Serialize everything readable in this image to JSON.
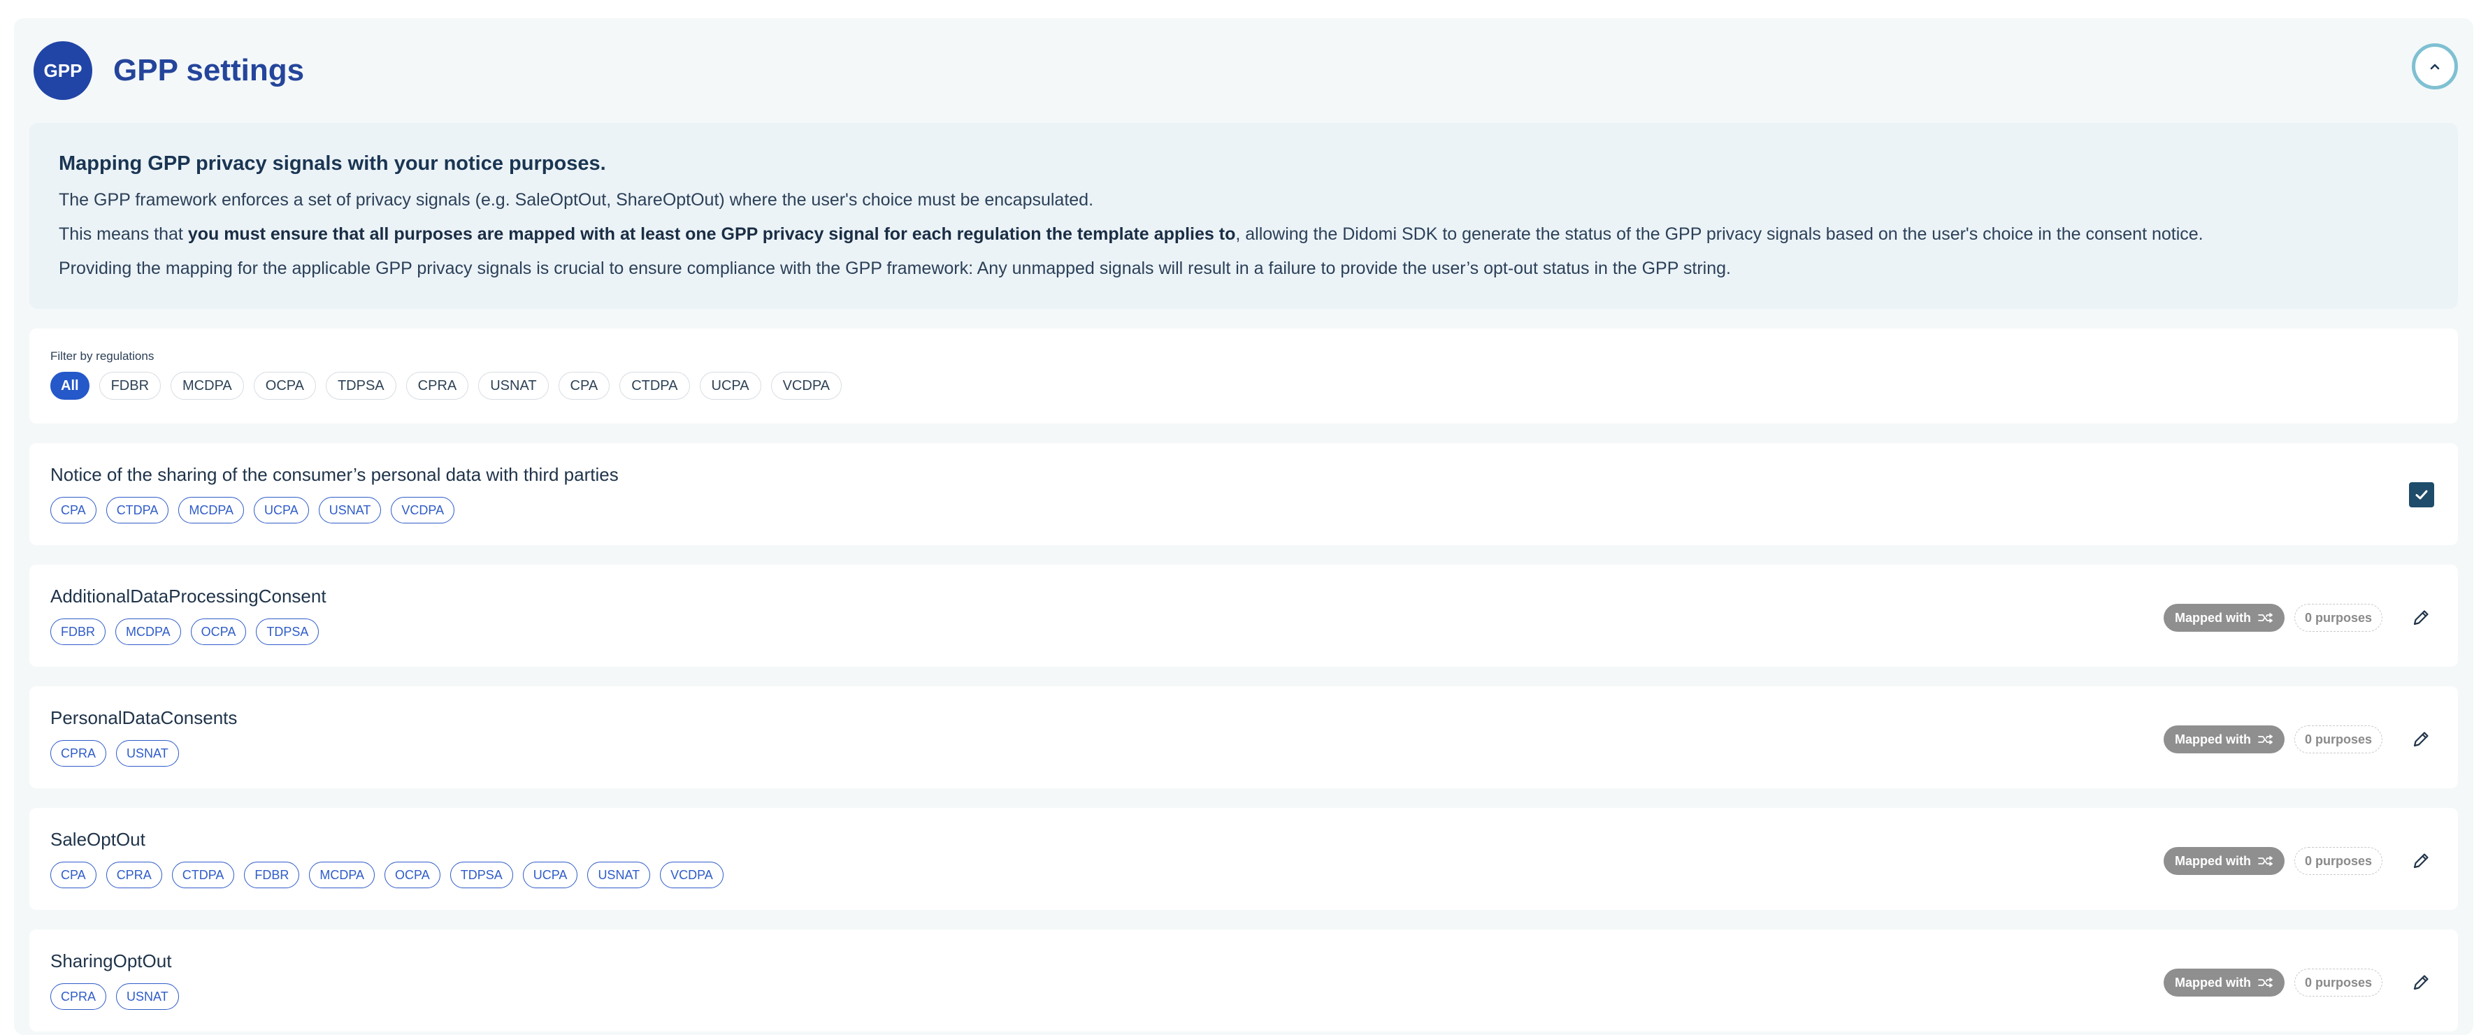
{
  "header": {
    "badge": "GPP",
    "title": "GPP settings"
  },
  "info": {
    "title": "Mapping GPP privacy signals with your notice purposes.",
    "line1": "The GPP framework enforces a set of privacy signals (e.g. SaleOptOut, ShareOptOut) where the user's choice must be encapsulated.",
    "line2_prefix": "This means that ",
    "line2_bold": "you must ensure that all purposes are mapped with at least one GPP privacy signal for each regulation the template applies to",
    "line2_suffix": ", allowing the Didomi SDK to generate the status of the GPP privacy signals based on the user's choice in the consent notice.",
    "line3": "Providing the mapping for the applicable GPP privacy signals is crucial to ensure compliance with the GPP framework: Any unmapped signals will result in a failure to provide the user’s opt-out status in the GPP string."
  },
  "filter": {
    "label": "Filter by regulations",
    "chips": [
      "All",
      "FDBR",
      "MCDPA",
      "OCPA",
      "TDPSA",
      "CPRA",
      "USNAT",
      "CPA",
      "CTDPA",
      "UCPA",
      "VCDPA"
    ]
  },
  "notice": {
    "title": "Notice of the sharing of the consumer’s personal data with third parties",
    "tags": [
      "CPA",
      "CTDPA",
      "MCDPA",
      "UCPA",
      "USNAT",
      "VCDPA"
    ]
  },
  "mapped_label": "Mapped with",
  "signals": [
    {
      "name": "AdditionalDataProcessingConsent",
      "tags": [
        "FDBR",
        "MCDPA",
        "OCPA",
        "TDPSA"
      ],
      "purposes": "0 purposes"
    },
    {
      "name": "PersonalDataConsents",
      "tags": [
        "CPRA",
        "USNAT"
      ],
      "purposes": "0 purposes"
    },
    {
      "name": "SaleOptOut",
      "tags": [
        "CPA",
        "CPRA",
        "CTDPA",
        "FDBR",
        "MCDPA",
        "OCPA",
        "TDPSA",
        "UCPA",
        "USNAT",
        "VCDPA"
      ],
      "purposes": "0 purposes"
    },
    {
      "name": "SharingOptOut",
      "tags": [
        "CPRA",
        "USNAT"
      ],
      "purposes": "0 purposes"
    }
  ],
  "icons": {
    "collapse": "chevron-up-icon",
    "mapped": "shuffle-icon",
    "edit": "pencil-icon",
    "check": "check-icon"
  },
  "colors": {
    "brand": "#2145a6",
    "chip_active": "#2558c9",
    "tag": "#2f5cc9",
    "mapped_bg": "#8f8f8f",
    "check_bg": "#1e4c6a"
  }
}
